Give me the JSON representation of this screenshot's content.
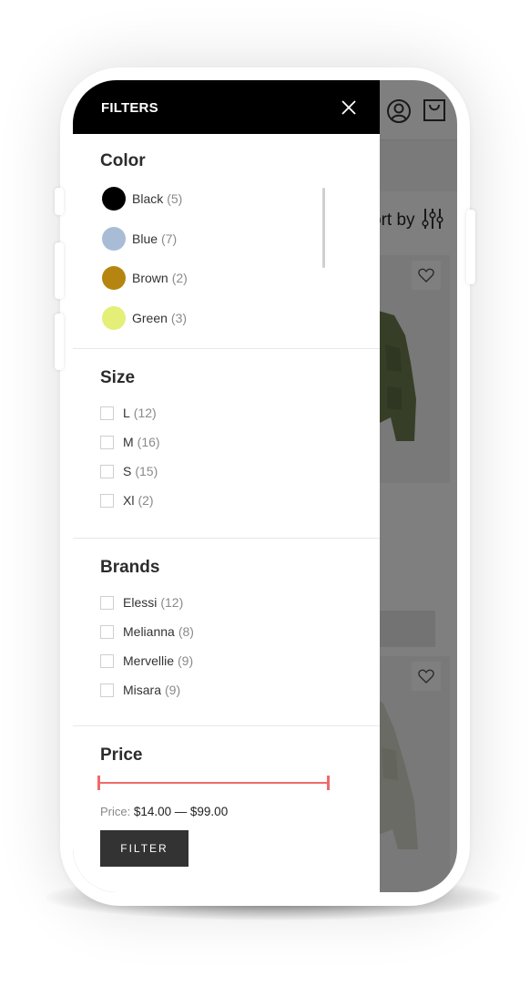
{
  "colors": {
    "header_bg": "#000000",
    "accent_slider": "#ef6b6b",
    "button_bg": "#333333",
    "overlay": "rgba(0,0,0,0.5)"
  },
  "background_page": {
    "sort_label": "ort by",
    "icons": [
      "account-icon",
      "shopping-bag-icon",
      "sort-sliders-icon",
      "heart-icon"
    ]
  },
  "filters": {
    "title": "FILTERS",
    "close_icon": "close-icon",
    "color": {
      "title": "Color",
      "items": [
        {
          "label": "Black",
          "count": "(5)",
          "swatch": "#000000"
        },
        {
          "label": "Blue",
          "count": "(7)",
          "swatch": "#a9bcd6"
        },
        {
          "label": "Brown",
          "count": "(2)",
          "swatch": "#b5850f"
        },
        {
          "label": "Green",
          "count": "(3)",
          "swatch": "#e4ef77"
        }
      ]
    },
    "size": {
      "title": "Size",
      "items": [
        {
          "label": "L",
          "count": "(12)"
        },
        {
          "label": "M",
          "count": "(16)"
        },
        {
          "label": "S",
          "count": "(15)"
        },
        {
          "label": "Xl",
          "count": "(2)"
        }
      ]
    },
    "brands": {
      "title": "Brands",
      "items": [
        {
          "label": "Elessi",
          "count": "(12)"
        },
        {
          "label": "Melianna",
          "count": "(8)"
        },
        {
          "label": "Mervellie",
          "count": "(9)"
        },
        {
          "label": "Misara",
          "count": "(9)"
        }
      ]
    },
    "price": {
      "title": "Price",
      "prefix": "Price:",
      "min": "$14.00",
      "separator": "—",
      "max": "$99.00",
      "button_label": "FILTER"
    }
  }
}
